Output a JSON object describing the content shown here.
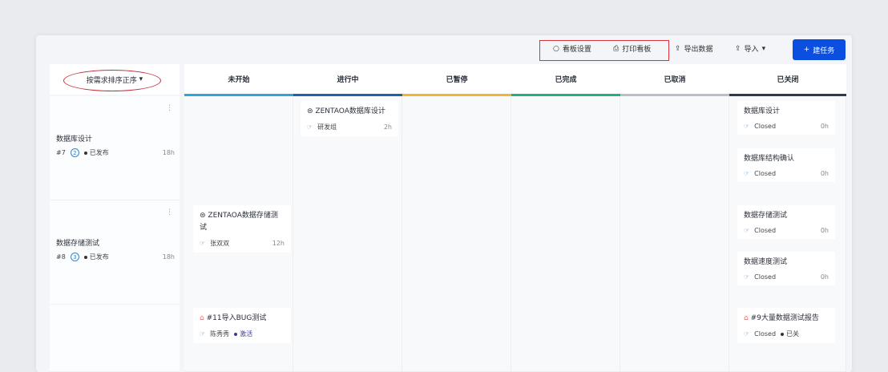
{
  "toolbar": {
    "board_settings": "看板设置",
    "print_board": "打印看板",
    "export": "导出数据",
    "import": "导入",
    "new_task": "建任务"
  },
  "sort_label": "按需求排序正序",
  "columns": [
    "未开始",
    "进行中",
    "已暂停",
    "已完成",
    "已取消",
    "已关闭"
  ],
  "colors": {
    "accent": "#0b4fe0",
    "col_underlines": [
      "#2aa7d8",
      "#1f5fb8",
      "#f2b531",
      "#22b07d",
      "#b9c0c8",
      "#2e3a52"
    ]
  },
  "lanes": [
    {
      "title": "数据库设计",
      "id": "#7",
      "count": "2",
      "status": "已发布",
      "hours": "18h"
    },
    {
      "title": "数据存储测试",
      "id": "#8",
      "count": "3",
      "status": "已发布",
      "hours": "18h"
    }
  ],
  "cards": {
    "l1_doing": {
      "title": "ZENTAOA数据库设计",
      "user": "研发组",
      "hours": "2h"
    },
    "l2_todo": {
      "title": "ZENTAOA数据存储测试",
      "user": "张双双",
      "hours": "12h"
    },
    "l3_todo": {
      "title": "#11导入BUG测试",
      "user": "陈秀秀",
      "status": "激活"
    },
    "closed": [
      {
        "title": "数据库设计",
        "status": "Closed",
        "hours": "0h"
      },
      {
        "title": "数据库结构确认",
        "status": "Closed",
        "hours": "0h"
      },
      {
        "title": "数据存储测试",
        "status": "Closed",
        "hours": "0h"
      },
      {
        "title": "数据速度测试",
        "status": "Closed",
        "hours": "0h"
      },
      {
        "title": "#9大量数据测试报告",
        "status": "Closed",
        "extra": "已关"
      }
    ]
  }
}
